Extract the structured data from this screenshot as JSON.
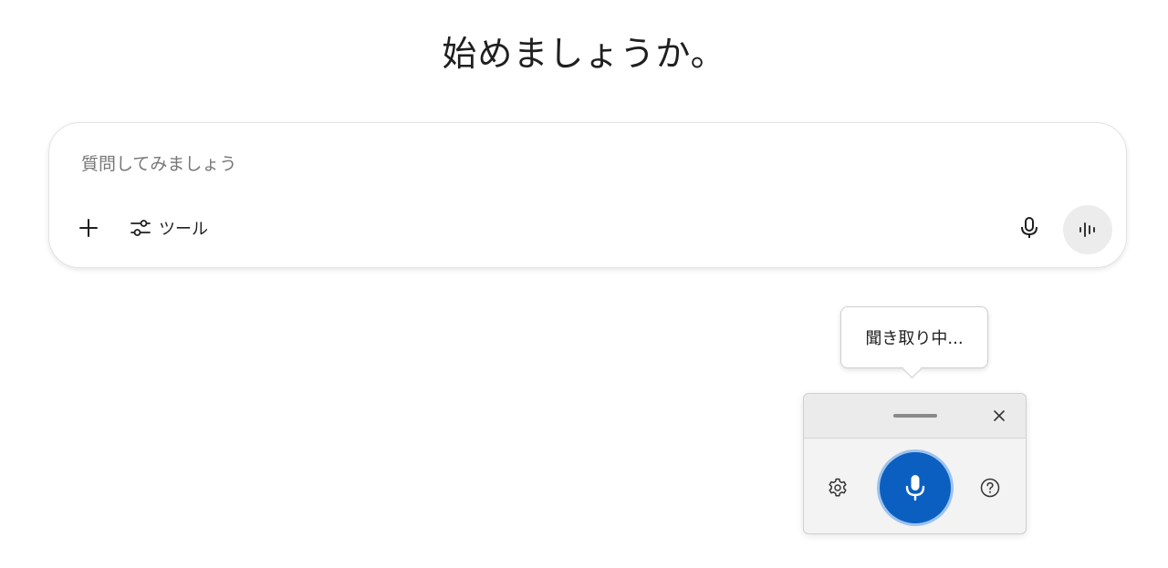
{
  "heading": "始めましょうか。",
  "prompt": {
    "placeholder": "質問してみましょう",
    "value": "",
    "add_icon": "plus-icon",
    "tools_icon": "sliders-icon",
    "tools_label": "ツール",
    "mic_icon": "microphone-icon",
    "live_icon": "audio-waveform-icon"
  },
  "voice_typing": {
    "status": "聞き取り中...",
    "drag_icon": "drag-handle-icon",
    "close_icon": "close-icon",
    "settings_icon": "gear-icon",
    "mic_icon": "microphone-icon",
    "help_icon": "help-circle-icon",
    "accent_color": "#0b5fc0"
  }
}
